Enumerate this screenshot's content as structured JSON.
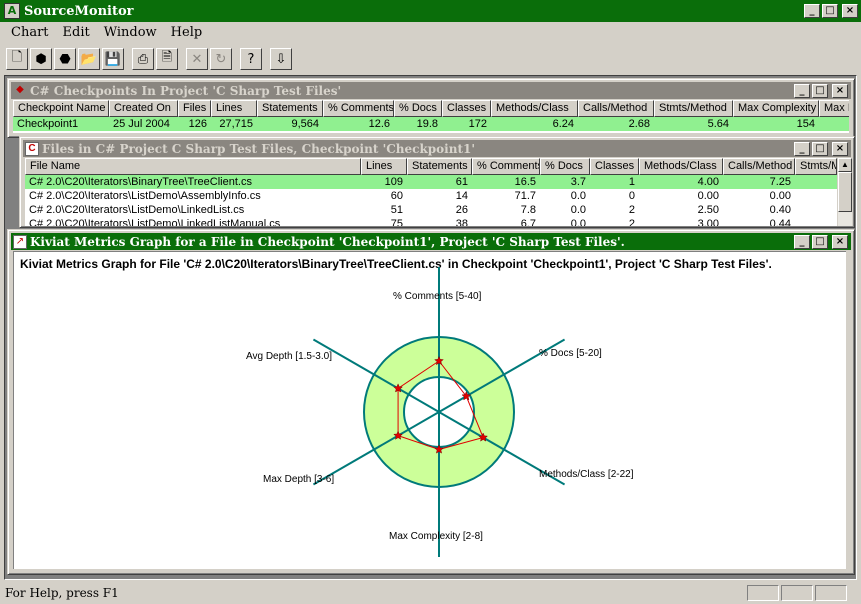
{
  "app": {
    "title": "SourceMonitor",
    "icon_glyph": "A"
  },
  "menu": [
    "Chart",
    "Edit",
    "Window",
    "Help"
  ],
  "toolbar": [
    {
      "icon": "new-file-icon",
      "glyph": "🗋"
    },
    {
      "icon": "new-project-icon",
      "glyph": "⬢"
    },
    {
      "icon": "project-icon",
      "glyph": "⬣"
    },
    {
      "icon": "open-folder-icon",
      "glyph": "📂"
    },
    {
      "icon": "save-icon",
      "glyph": "💾"
    },
    {
      "icon": "print-icon",
      "glyph": "⎙"
    },
    {
      "icon": "print-preview-icon",
      "glyph": "🗎"
    },
    {
      "icon": "delete-icon",
      "glyph": "✕"
    },
    {
      "icon": "refresh-icon",
      "glyph": "↻"
    },
    {
      "icon": "context-help-icon",
      "glyph": "?"
    },
    {
      "icon": "export-icon",
      "glyph": "⇩"
    }
  ],
  "checkpoints": {
    "title": "C# Checkpoints In Project 'C Sharp Test Files'",
    "columns": [
      "Checkpoint Name",
      "Created On",
      "Files",
      "Lines",
      "Statements",
      "% Comments",
      "% Docs",
      "Classes",
      "Methods/Class",
      "Calls/Method",
      "Stmts/Method",
      "Max Complexity",
      "Max De"
    ],
    "rows": [
      [
        "Checkpoint1",
        "25 Jul 2004",
        "126",
        "27,715",
        "9,564",
        "12.6",
        "19.8",
        "172",
        "6.24",
        "2.68",
        "5.64",
        "154",
        ""
      ]
    ]
  },
  "files": {
    "title": "Files in C# Project C Sharp Test Files, Checkpoint 'Checkpoint1'",
    "columns": [
      "File Name",
      "Lines",
      "Statements",
      "% Comments",
      "% Docs",
      "Classes",
      "Methods/Class",
      "Calls/Method",
      "Stmts/M"
    ],
    "rows": [
      [
        "C# 2.0\\C20\\Iterators\\BinaryTree\\TreeClient.cs",
        "109",
        "61",
        "16.5",
        "3.7",
        "1",
        "4.00",
        "7.25",
        ""
      ],
      [
        "C# 2.0\\C20\\Iterators\\ListDemo\\AssemblyInfo.cs",
        "60",
        "14",
        "71.7",
        "0.0",
        "0",
        "0.00",
        "0.00",
        ""
      ],
      [
        "C# 2.0\\C20\\Iterators\\ListDemo\\LinkedList.cs",
        "51",
        "26",
        "7.8",
        "0.0",
        "2",
        "2.50",
        "0.40",
        ""
      ],
      [
        "C# 2.0\\C20\\Iterators\\ListDemo\\LinkedListManual.cs",
        "75",
        "38",
        "6.7",
        "0.0",
        "2",
        "3.00",
        "0.44",
        ""
      ]
    ]
  },
  "kiviat": {
    "title": "Kiviat Metrics Graph for a File in Checkpoint 'Checkpoint1', Project 'C Sharp Test Files'.",
    "heading": "Kiviat Metrics Graph for File 'C# 2.0\\C20\\Iterators\\BinaryTree\\TreeClient.cs' in Checkpoint 'Checkpoint1', Project 'C Sharp Test Files'.",
    "axes": [
      {
        "label": "% Comments [5-40]",
        "value": 0.68
      },
      {
        "label": "% Docs [5-20]",
        "value": 0.42
      },
      {
        "label": "Methods/Class [2-22]",
        "value": 0.68
      },
      {
        "label": "Max Complexity [2-8]",
        "value": 0.5
      },
      {
        "label": "Max Depth [3-6]",
        "value": 0.63
      },
      {
        "label": "Avg Depth [1.5-3.0]",
        "value": 0.63
      }
    ],
    "normal_band_color": "#ccff99",
    "axis_color": "#007a7a",
    "polygon_color": "#e00000"
  },
  "status": {
    "text": "For Help, press F1"
  }
}
